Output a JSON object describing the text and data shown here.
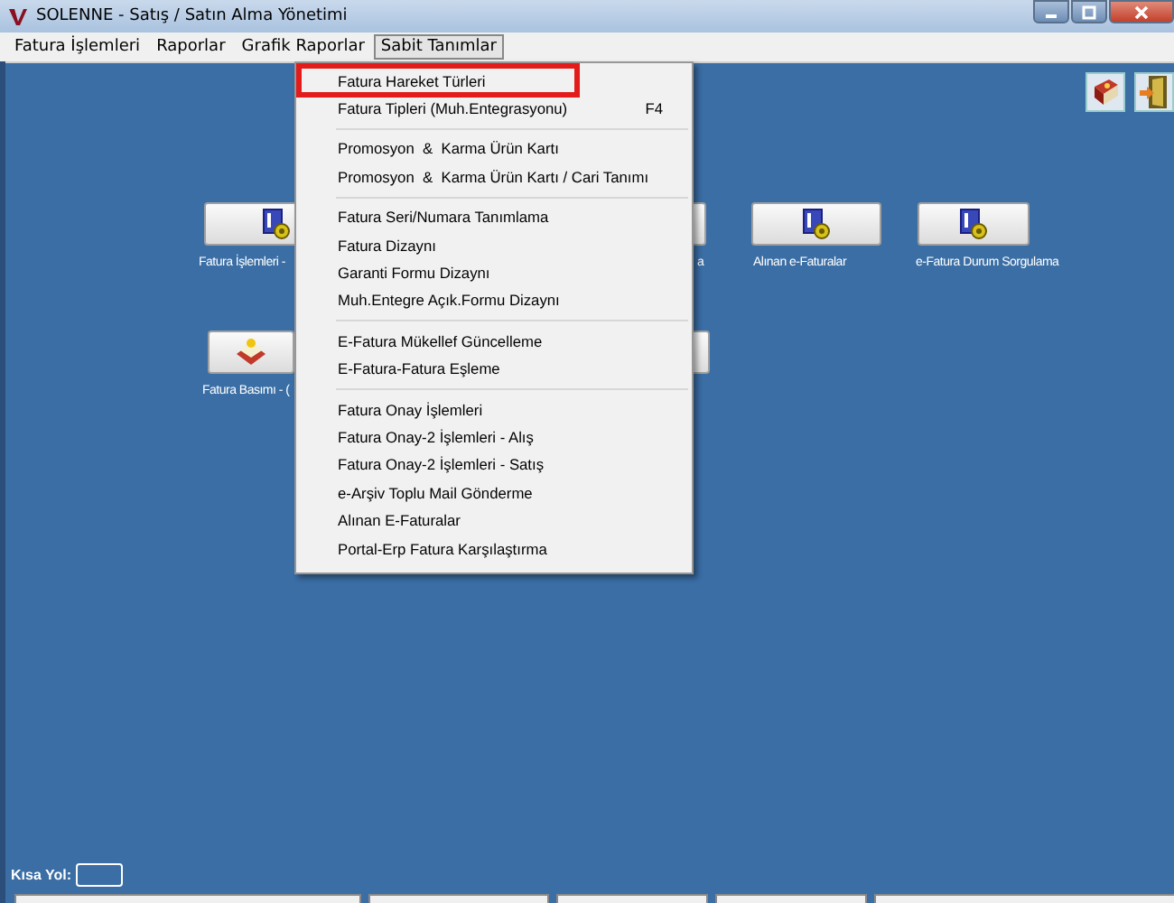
{
  "window": {
    "title": "SOLENNE - Satış / Satın Alma Yönetimi"
  },
  "menubar": [
    {
      "label": "Fatura İşlemleri",
      "selected": false
    },
    {
      "label": "Raporlar",
      "selected": false
    },
    {
      "label": "Grafik Raporlar",
      "selected": false
    },
    {
      "label": "Sabit Tanımlar",
      "selected": true
    }
  ],
  "menu": {
    "groups": [
      [
        {
          "label": "Fatura Hareket Türleri",
          "annotated": true
        },
        {
          "label": "Fatura Tipleri (Muh.Entegrasyonu)",
          "shortcut": "F4",
          "annotated": false
        }
      ],
      [
        {
          "label": "Promosyon  &  Karma Ürün Kartı",
          "annotated": false
        },
        {
          "label": "Promosyon  &  Karma Ürün Kartı / Cari Tanımı",
          "annotated": false
        }
      ],
      [
        {
          "label": "Fatura Seri/Numara Tanımlama",
          "annotated": false
        },
        {
          "label": "Fatura Dizaynı",
          "annotated": false
        },
        {
          "label": "Garanti Formu Dizaynı",
          "annotated": false
        },
        {
          "label": "Muh.Entegre Açık.Formu Dizaynı",
          "annotated": false
        }
      ],
      [
        {
          "label": "E-Fatura Mükellef Güncelleme",
          "annotated": false
        },
        {
          "label": "E-Fatura-Fatura Eşleme",
          "annotated": false
        }
      ],
      [
        {
          "label": "Fatura Onay İşlemleri",
          "annotated": false
        },
        {
          "label": "Fatura Onay-2 İşlemleri - Alış",
          "annotated": false
        },
        {
          "label": "Fatura Onay-2 İşlemleri - Satış",
          "annotated": false
        },
        {
          "label": "e-Arşiv Toplu Mail Gönderme",
          "annotated": false
        },
        {
          "label": "Alınan E-Faturalar",
          "annotated": false
        },
        {
          "label": "Portal-Erp Fatura Karşılaştırma",
          "annotated": false
        }
      ]
    ]
  },
  "shortcuts": [
    {
      "label": "Fatura İşlemleri -",
      "kind": "document"
    },
    {
      "label": "a",
      "kind": "partial"
    },
    {
      "label": "Alınan e-Faturalar",
      "kind": "document"
    },
    {
      "label": "e-Fatura Durum Sorgulama",
      "kind": "document"
    },
    {
      "label": "Fatura Basımı - (",
      "kind": "gift"
    },
    {
      "kind": "partial"
    }
  ],
  "kisa_yol": {
    "label": "Kısa Yol:"
  }
}
